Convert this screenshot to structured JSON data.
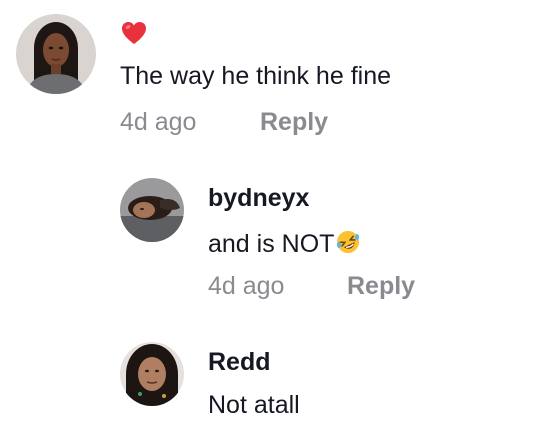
{
  "comments": [
    {
      "username": "",
      "reaction_icon": "red-heart-icon",
      "text": "The way he think he fine",
      "time": "4d ago",
      "reply_label": "Reply",
      "avatar": "avatar-woman-long-dark-hair"
    },
    {
      "username": "bydneyx",
      "text": "and is NOT",
      "text_emoji": "rofl-emoji-icon",
      "time": "4d ago",
      "reply_label": "Reply",
      "avatar": "avatar-person-lying-down"
    },
    {
      "username": "Redd",
      "text": "Not atall",
      "avatar": "avatar-woman-curly-hair"
    }
  ],
  "colors": {
    "primary_text": "#161823",
    "secondary_text": "#8a8b91",
    "heart": "#e8313c",
    "background": "#ffffff"
  }
}
